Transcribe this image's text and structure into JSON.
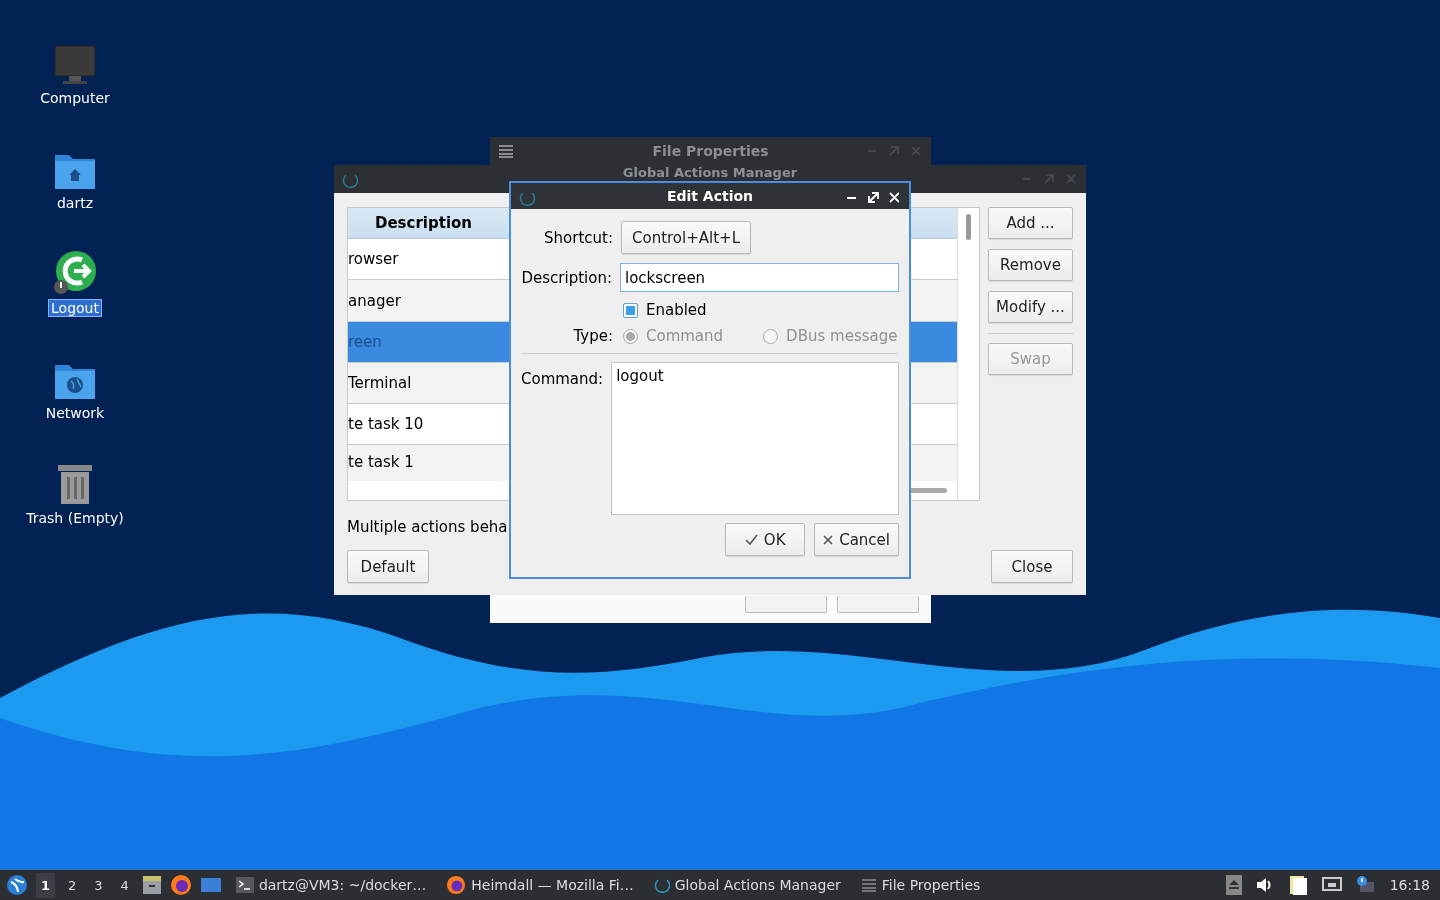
{
  "desktop_icons": [
    {
      "label": "Computer",
      "selected": false,
      "kind": "computer"
    },
    {
      "label": "dartz",
      "selected": false,
      "kind": "home"
    },
    {
      "label": "Logout",
      "selected": true,
      "kind": "logout"
    },
    {
      "label": "Network",
      "selected": false,
      "kind": "network"
    },
    {
      "label": "Trash (Empty)",
      "selected": false,
      "kind": "trash"
    }
  ],
  "file_properties_window": {
    "title": "File Properties"
  },
  "global_actions_window": {
    "title": "Global Actions Manager",
    "table": {
      "columns": [
        "Description"
      ],
      "rows": [
        {
          "cell": "rowser",
          "selected": false
        },
        {
          "cell": "anager",
          "selected": false
        },
        {
          "cell": "reen",
          "selected": true
        },
        {
          "cell": "Terminal",
          "selected": false
        },
        {
          "cell": "te task 10",
          "selected": false
        },
        {
          "cell": "te task 1",
          "selected": false
        }
      ]
    },
    "side_buttons": [
      {
        "label": "Add ...",
        "disabled": false
      },
      {
        "label": "Remove",
        "disabled": false
      },
      {
        "label": "Modify ...",
        "disabled": false
      },
      {
        "label": "Swap",
        "disabled": true
      }
    ],
    "behaviour_label": "Multiple actions beha",
    "default_button": "Default",
    "close_button": "Close"
  },
  "edit_action_dialog": {
    "title": "Edit Action",
    "shortcut_label": "Shortcut:",
    "shortcut": "Control+Alt+L",
    "description_label": "Description:",
    "description": "lockscreen",
    "enabled": {
      "label": "Enabled",
      "checked": true
    },
    "type_label": "Type:",
    "types": [
      {
        "label": "Command",
        "selected": true,
        "disabled": true
      },
      {
        "label": "DBus message",
        "selected": false,
        "disabled": true
      }
    ],
    "command_label": "Command:",
    "command": "logout",
    "ok": "OK",
    "cancel": "Cancel"
  },
  "taskbar": {
    "workspaces": [
      {
        "label": "1",
        "selected": true
      },
      {
        "label": "2",
        "selected": false
      },
      {
        "label": "3",
        "selected": false
      },
      {
        "label": "4",
        "selected": false
      }
    ],
    "tasks": [
      {
        "label": "dartz@VM3: ~/docker…",
        "kind": "terminal"
      },
      {
        "label": "Heimdall — Mozilla Fi…",
        "kind": "firefox"
      },
      {
        "label": "Global Actions Manager",
        "kind": "actions"
      },
      {
        "label": "File Properties",
        "kind": "menu"
      }
    ],
    "clock": "16:18"
  }
}
